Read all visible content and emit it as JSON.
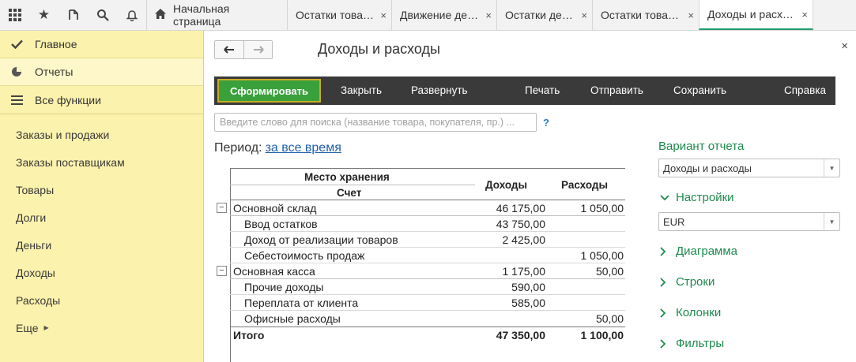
{
  "tabs": {
    "home": "Начальная страница",
    "items": [
      {
        "label": "Остатки товаров",
        "active": false
      },
      {
        "label": "Движение денежных средств",
        "active": false
      },
      {
        "label": "Остатки денег",
        "active": false
      },
      {
        "label": "Остатки товаров",
        "active": false
      },
      {
        "label": "Доходы и расходы",
        "active": true
      }
    ],
    "close_glyph": "×"
  },
  "sidebar": {
    "main": [
      "Главное",
      "Отчеты",
      "Все функции"
    ],
    "sections": [
      "Заказы и продажи",
      "Заказы поставщикам",
      "Товары",
      "Долги",
      "Деньги",
      "Доходы",
      "Расходы",
      "Еще"
    ]
  },
  "page": {
    "title": "Доходы и расходы",
    "close": "×",
    "back": "🡐",
    "forward": "🡒"
  },
  "toolbar": {
    "generate": "Сформировать",
    "close": "Закрыть",
    "expand": "Развернуть",
    "print": "Печать",
    "send": "Отправить",
    "save": "Сохранить",
    "help": "Справка"
  },
  "search": {
    "placeholder": "Введите слово для поиска (название товара, покупателя, пр.) ...",
    "help": "?"
  },
  "period": {
    "label": "Период:",
    "value": "за все время"
  },
  "report": {
    "headers": {
      "storage": "Место хранения",
      "account": "Счет",
      "income": "Доходы",
      "expense": "Расходы"
    },
    "rows": [
      {
        "label": "Основной склад",
        "income": "46 175,00",
        "expense": "1 050,00",
        "level": 0
      },
      {
        "label": "Ввод остатков",
        "income": "43 750,00",
        "expense": "",
        "level": 1
      },
      {
        "label": "Доход от реализации товаров",
        "income": "2 425,00",
        "expense": "",
        "level": 1
      },
      {
        "label": "Себестоимость продаж",
        "income": "",
        "expense": "1 050,00",
        "level": 1
      },
      {
        "label": "Основная касса",
        "income": "1 175,00",
        "expense": "50,00",
        "level": 0
      },
      {
        "label": "Прочие доходы",
        "income": "590,00",
        "expense": "",
        "level": 1
      },
      {
        "label": "Переплата от клиента",
        "income": "585,00",
        "expense": "",
        "level": 1
      },
      {
        "label": "Офисные расходы",
        "income": "",
        "expense": "50,00",
        "level": 1
      }
    ],
    "total": {
      "label": "Итого",
      "income": "47 350,00",
      "expense": "1 100,00"
    },
    "toggle_glyph": "−"
  },
  "settings_panel": {
    "variant_title": "Вариант отчета",
    "variant_value": "Доходы и расходы",
    "settings_title": "Настройки",
    "currency_value": "EUR",
    "sections": [
      "Диаграмма",
      "Строки",
      "Колонки",
      "Фильтры"
    ]
  },
  "colors": {
    "sidebar_bg": "#fbf2ad",
    "primary_button": "#3aa03c",
    "toolbar_bg": "#3a3a3a",
    "accent_green": "#1d8a4c",
    "link_blue": "#1f5fa8"
  }
}
